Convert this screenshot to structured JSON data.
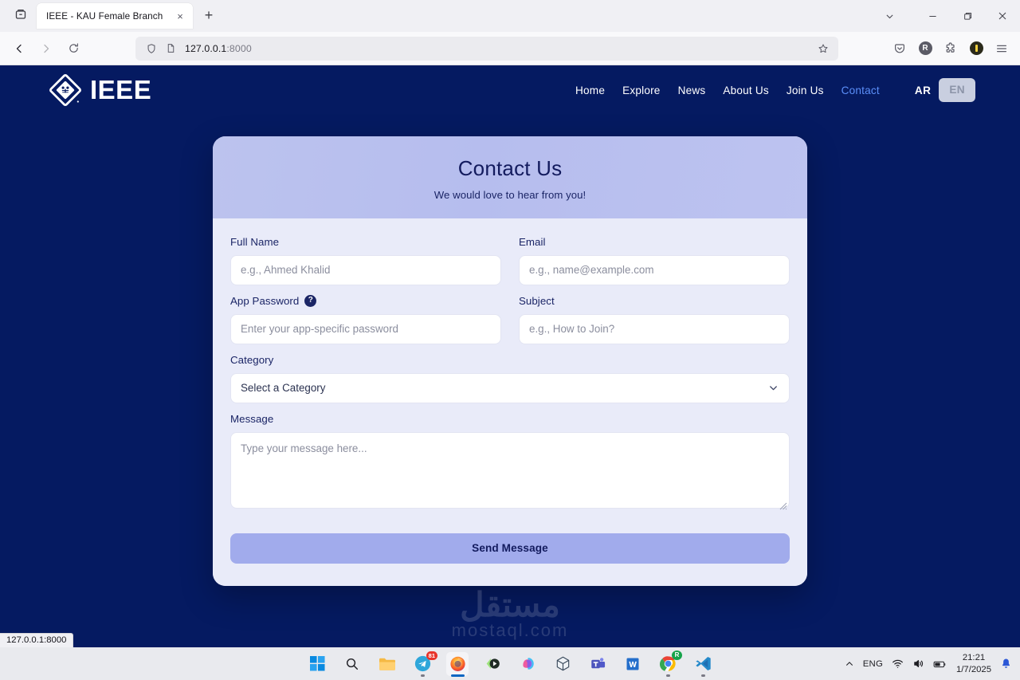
{
  "browser": {
    "tab": {
      "title": "IEEE - KAU Female Branch",
      "close_label": "×"
    },
    "new_tab_label": "+",
    "url": {
      "host": "127.0.0.1",
      "port": ":8000"
    },
    "status_bar": "127.0.0.1:8000",
    "toolbar_icons": [
      "pocket-icon",
      "account-avatar",
      "extensions-icon",
      "shield-extension-icon",
      "app-menu-icon"
    ],
    "avatar_letter": "R",
    "window_controls": [
      "list-all-tabs",
      "minimize",
      "maximize",
      "close"
    ]
  },
  "site": {
    "brand": "IEEE",
    "nav": [
      {
        "label": "Home",
        "active": false
      },
      {
        "label": "Explore",
        "active": false
      },
      {
        "label": "News",
        "active": false
      },
      {
        "label": "About Us",
        "active": false
      },
      {
        "label": "Join Us",
        "active": false
      },
      {
        "label": "Contact",
        "active": true
      }
    ],
    "lang": {
      "ar": "AR",
      "en": "EN"
    },
    "colors": {
      "page_bg": "#051a61",
      "accent_link": "#5b8ff9",
      "card_header_from": "#bcc3ee",
      "card_body": "#e9ebf9",
      "button": "#a1abec",
      "text_navy": "#131b5e"
    }
  },
  "card": {
    "title": "Contact Us",
    "subtitle": "We would love to hear from you!",
    "fields": {
      "full_name": {
        "label": "Full Name",
        "placeholder": "e.g., Ahmed Khalid",
        "value": ""
      },
      "email": {
        "label": "Email",
        "placeholder": "e.g., name@example.com",
        "value": ""
      },
      "app_password": {
        "label": "App Password",
        "placeholder": "Enter your app-specific password",
        "value": "",
        "help": "?"
      },
      "subject": {
        "label": "Subject",
        "placeholder": "e.g., How to Join?",
        "value": ""
      },
      "category": {
        "label": "Category",
        "selected": "Select a Category"
      },
      "message": {
        "label": "Message",
        "placeholder": "Type your message here...",
        "value": ""
      }
    },
    "submit_label": "Send Message"
  },
  "watermark": {
    "arabic": "مستقل",
    "latin": "mostaql.com"
  },
  "taskbar": {
    "apps": [
      {
        "name": "start-button"
      },
      {
        "name": "search-button"
      },
      {
        "name": "file-explorer"
      },
      {
        "name": "telegram",
        "badge": "81"
      },
      {
        "name": "firefox",
        "active": true
      },
      {
        "name": "media-player"
      },
      {
        "name": "copilot"
      },
      {
        "name": "3d-viewer"
      },
      {
        "name": "microsoft-teams"
      },
      {
        "name": "microsoft-word"
      },
      {
        "name": "google-chrome",
        "badge": "R"
      },
      {
        "name": "vs-code"
      }
    ],
    "tray": {
      "language": "ENG",
      "time": "21:21",
      "date": "1/7/2025"
    }
  }
}
